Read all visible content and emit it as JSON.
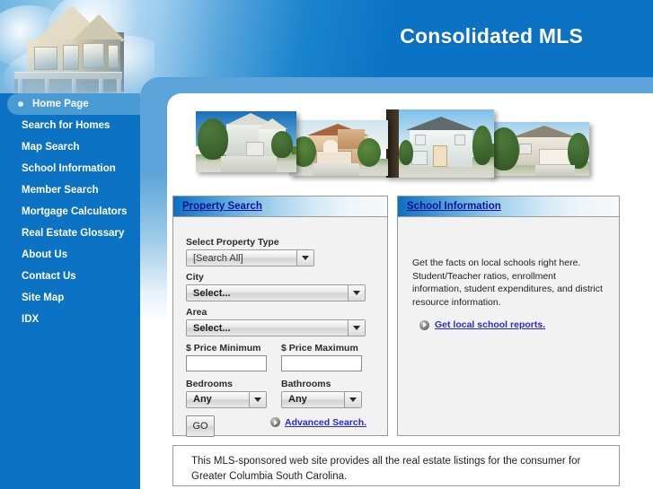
{
  "header": {
    "title": "Consolidated MLS",
    "house_image_alt": "victorian-house-photo"
  },
  "sidebar": {
    "items": [
      {
        "label": "Home Page",
        "active": true
      },
      {
        "label": "Search for Homes",
        "active": false
      },
      {
        "label": "Map Search",
        "active": false
      },
      {
        "label": "School Information",
        "active": false
      },
      {
        "label": "Member Search",
        "active": false
      },
      {
        "label": "Mortgage Calculators",
        "active": false
      },
      {
        "label": "Real Estate Glossary",
        "active": false
      },
      {
        "label": "About Us",
        "active": false
      },
      {
        "label": "Contact Us",
        "active": false
      },
      {
        "label": "Site Map",
        "active": false
      },
      {
        "label": "IDX",
        "active": false
      }
    ]
  },
  "banner": {
    "photos": [
      "house-photo-1",
      "house-photo-2",
      "house-photo-3",
      "house-photo-4"
    ]
  },
  "property_search": {
    "title": "Property Search",
    "property_type_label": "Select Property Type",
    "property_type_value": "[Search All]",
    "city_label": "City",
    "city_value": "Select...",
    "area_label": "Area",
    "area_value": "Select...",
    "price_min_label": "$ Price Minimum",
    "price_min_value": "",
    "price_max_label": "$ Price Maximum",
    "price_max_value": "",
    "bedrooms_label": "Bedrooms",
    "bedrooms_value": "Any",
    "bathrooms_label": "Bathrooms",
    "bathrooms_value": "Any",
    "go_label": "GO",
    "advanced_search_label": "Advanced Search."
  },
  "school_information": {
    "title": "School Information",
    "body": "Get the facts on local schools right here. Student/Teacher ratios, enrollment information, student expenditures, and district resource information.",
    "link_label": "Get local school reports."
  },
  "footer": {
    "text": "This MLS-sponsored web site provides all the real estate listings for the consumer for Greater Columbia South Carolina."
  },
  "colors": {
    "brand_blue": "#0b72c4",
    "band_blue": "#5ba3d9",
    "active_nav": "#4a9ad4",
    "link_blue": "#2a2ad0",
    "panel_title": "#10109a",
    "panel_bg": "#f2f2f2"
  }
}
